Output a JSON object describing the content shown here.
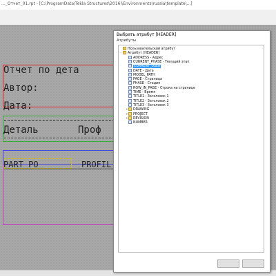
{
  "window": {
    "title": "..._Отчет_01.rpt - [C:\\ProgramData\\Tekla Structures\\2016i\\Environments\\russia\\template\\...]"
  },
  "report": {
    "header_title": "Отчет по дета",
    "author_label": "Автор:",
    "date_label": "Дата:",
    "col_detail": "Деталь",
    "col_profile": "Проф",
    "row_part": "PART_PO",
    "row_profile": "PROFIL"
  },
  "dialog": {
    "title": "Выбрать атрибут [HEADER]",
    "label": "Атрибуты",
    "tree": [
      {
        "level": 0,
        "kind": "folder",
        "expand": "",
        "text": "Пользовательский атрибут"
      },
      {
        "level": 0,
        "kind": "folder",
        "expand": "-",
        "text": "Атрибут [HEADER]"
      },
      {
        "level": 1,
        "kind": "doc",
        "expand": "",
        "text": "ADDRESS - Адрес"
      },
      {
        "level": 1,
        "kind": "doc",
        "expand": "",
        "text": "CURRENT_PHASE - Текущий этап"
      },
      {
        "level": 1,
        "kind": "doc",
        "expand": "",
        "text": "CURRENT_USER",
        "selected": true
      },
      {
        "level": 1,
        "kind": "doc",
        "expand": "",
        "text": "DATE - Дата"
      },
      {
        "level": 1,
        "kind": "doc",
        "expand": "",
        "text": "MODEL_PATH"
      },
      {
        "level": 1,
        "kind": "doc",
        "expand": "",
        "text": "PAGE - Страница"
      },
      {
        "level": 1,
        "kind": "doc",
        "expand": "",
        "text": "PHASE - Стадия"
      },
      {
        "level": 1,
        "kind": "doc",
        "expand": "",
        "text": "ROW_IN_PAGE - Строка на странице"
      },
      {
        "level": 1,
        "kind": "doc",
        "expand": "",
        "text": "TIME - Время"
      },
      {
        "level": 1,
        "kind": "doc",
        "expand": "",
        "text": "TITLE1 - Заголовок 1"
      },
      {
        "level": 1,
        "kind": "doc",
        "expand": "",
        "text": "TITLE2 - Заголовок 2"
      },
      {
        "level": 1,
        "kind": "doc",
        "expand": "",
        "text": "TITLE3 - Заголовок 3"
      },
      {
        "level": 1,
        "kind": "folder",
        "expand": "+",
        "text": "DRAWING"
      },
      {
        "level": 1,
        "kind": "folder",
        "expand": "+",
        "text": "PROJECT"
      },
      {
        "level": 1,
        "kind": "folder",
        "expand": "+",
        "text": "REVISION"
      },
      {
        "level": 1,
        "kind": "doc",
        "expand": "",
        "text": "NUMBER"
      }
    ]
  }
}
